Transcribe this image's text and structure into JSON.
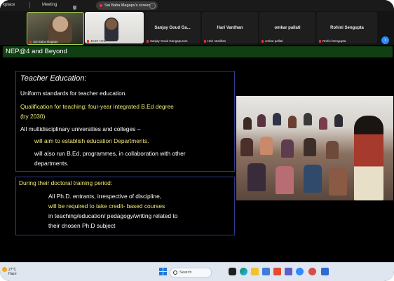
{
  "topbar": {
    "app_title": "kplace",
    "meeting_label": "Meeting",
    "share_label": "Sai Baba Magapu's screen"
  },
  "participants": [
    {
      "name": "Sai Baba Magapu",
      "type": "video"
    },
    {
      "name": "JCSF HYD",
      "type": "video"
    },
    {
      "name": "Sanjay Goud Gangapuram",
      "display": "Sanjay Goud Ga...",
      "type": "name"
    },
    {
      "name": "Hari Vardhan",
      "display": "Hari Vardhan",
      "type": "name"
    },
    {
      "name": "omkar pallati",
      "display": "omkar pallati",
      "type": "name"
    },
    {
      "name": "Rohini Sengupta",
      "display": "Rohini Sengupta",
      "type": "name"
    }
  ],
  "slide": {
    "title": "NEP@4 and Beyond",
    "box1": {
      "heading": "Teacher Education:",
      "line1": "Uniform standards for teacher education.",
      "line2": "Qualification for teaching: four-year integrated B.Ed degree",
      "line3": "(by 2030)",
      "line4": "All multidisciplinary universities and colleges –",
      "line5": "will aim to establish education Departments.",
      "line6": "will also run B.Ed. programmes, in collaboration with other",
      "line7": "departments."
    },
    "box2": {
      "heading": "During their doctoral training period:",
      "line1": "All Ph.D. entrants, irrespective of discipline,",
      "line2": "will be required to take credit- based courses",
      "line3": "in teaching/education/ pedagogy/writing related to",
      "line4": "their chosen Ph.D subject"
    },
    "colors": {
      "title_bar": "#0f3f12",
      "highlight": "#f1ea78",
      "box_border": "#2e3b8c"
    }
  },
  "taskbar": {
    "weather_temp": "27°C",
    "weather_desc": "Haze",
    "search_placeholder": "Search"
  }
}
